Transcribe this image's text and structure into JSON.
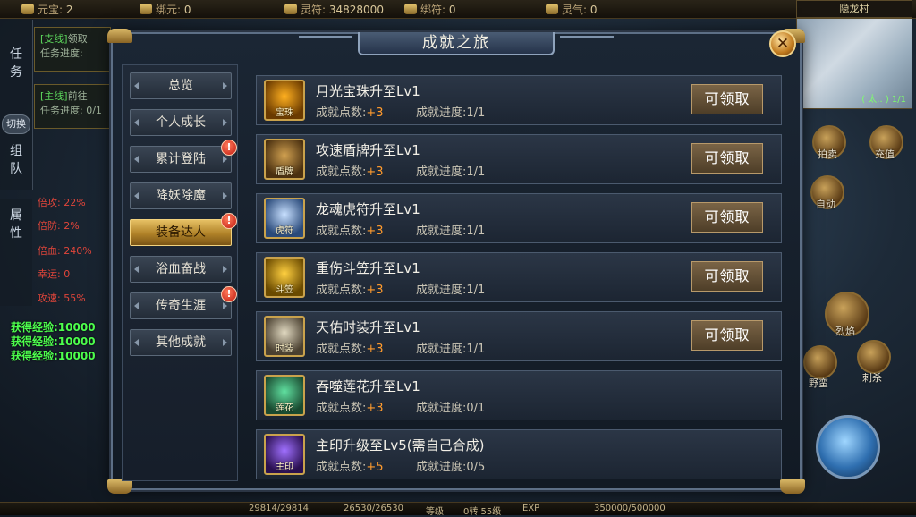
{
  "hud": {
    "gold_label": "元宝:",
    "gold_value": "2",
    "bound_label": "绑元:",
    "bound_value": "0",
    "coins_label": "灵符:",
    "coins_value": "34828000",
    "bound2_label": "绑符:",
    "bound2_value": "0",
    "misc_label": "灵气:",
    "misc_value": "0",
    "map_name": "隐龙村",
    "map_coord": "( 太.. ) 1/1",
    "left_tabs": [
      "任",
      "务",
      "组",
      "队"
    ],
    "switch_label": "切换",
    "task1_tag": "[支线]",
    "task1_text": "领取",
    "task1_progress": "任务进度:",
    "task2_tag": "[主线]",
    "task2_text": "前往",
    "task2_progress": "任务进度: 0/1",
    "attr_tabs": [
      "属",
      "性"
    ],
    "stats": [
      "倍攻: 22%",
      "倍防: 2%",
      "倍血: 240%",
      "幸运: 0",
      "攻速: 55%"
    ],
    "exp_lines": [
      "获得经验:10000",
      "获得经验:10000",
      "获得经验:10000"
    ],
    "bottom": {
      "hp": "29814/29814",
      "mp": "26530/26530",
      "level_label": "等级",
      "level_value": "0转 55级",
      "exp_label": "EXP",
      "exp_value": "350000/500000"
    },
    "right_buttons": [
      "拍卖",
      "充值",
      "自动",
      "烈焰",
      "野蛮",
      "刺杀"
    ]
  },
  "dialog": {
    "title": "成就之旅",
    "close_glyph": "✕",
    "nav": [
      {
        "label": "总览",
        "active": false,
        "badge": false
      },
      {
        "label": "个人成长",
        "active": false,
        "badge": false
      },
      {
        "label": "累计登陆",
        "active": false,
        "badge": true
      },
      {
        "label": "降妖除魔",
        "active": false,
        "badge": false
      },
      {
        "label": "装备达人",
        "active": true,
        "badge": true
      },
      {
        "label": "浴血奋战",
        "active": false,
        "badge": false
      },
      {
        "label": "传奇生涯",
        "active": false,
        "badge": true
      },
      {
        "label": "其他成就",
        "active": false,
        "badge": false
      }
    ],
    "badge_glyph": "!",
    "points_label": "成就点数:",
    "progress_label": "成就进度:",
    "claim_label": "可领取",
    "rows": [
      {
        "title": "月光宝珠升至Lv1",
        "icon_text": "宝珠",
        "icon_color": "#ffb020",
        "points": "+3",
        "progress": "1/1",
        "claimable": true
      },
      {
        "title": "攻速盾牌升至Lv1",
        "icon_text": "盾牌",
        "icon_color": "#d0a050",
        "points": "+3",
        "progress": "1/1",
        "claimable": true
      },
      {
        "title": "龙魂虎符升至Lv1",
        "icon_text": "虎符",
        "icon_color": "#a0c8ff",
        "points": "+3",
        "progress": "1/1",
        "claimable": true
      },
      {
        "title": "重伤斗笠升至Lv1",
        "icon_text": "斗笠",
        "icon_color": "#ffd040",
        "points": "+3",
        "progress": "1/1",
        "claimable": true
      },
      {
        "title": "天佑时装升至Lv1",
        "icon_text": "时装",
        "icon_color": "#e0d8c0",
        "points": "+3",
        "progress": "1/1",
        "claimable": true
      },
      {
        "title": "吞噬莲花升至Lv1",
        "icon_text": "莲花",
        "icon_color": "#60e0a0",
        "points": "+3",
        "progress": "0/1",
        "claimable": false
      },
      {
        "title": "主印升级至Lv5(需自己合成)",
        "icon_text": "主印",
        "icon_color": "#a070ff",
        "points": "+5",
        "progress": "0/5",
        "claimable": false
      }
    ]
  }
}
